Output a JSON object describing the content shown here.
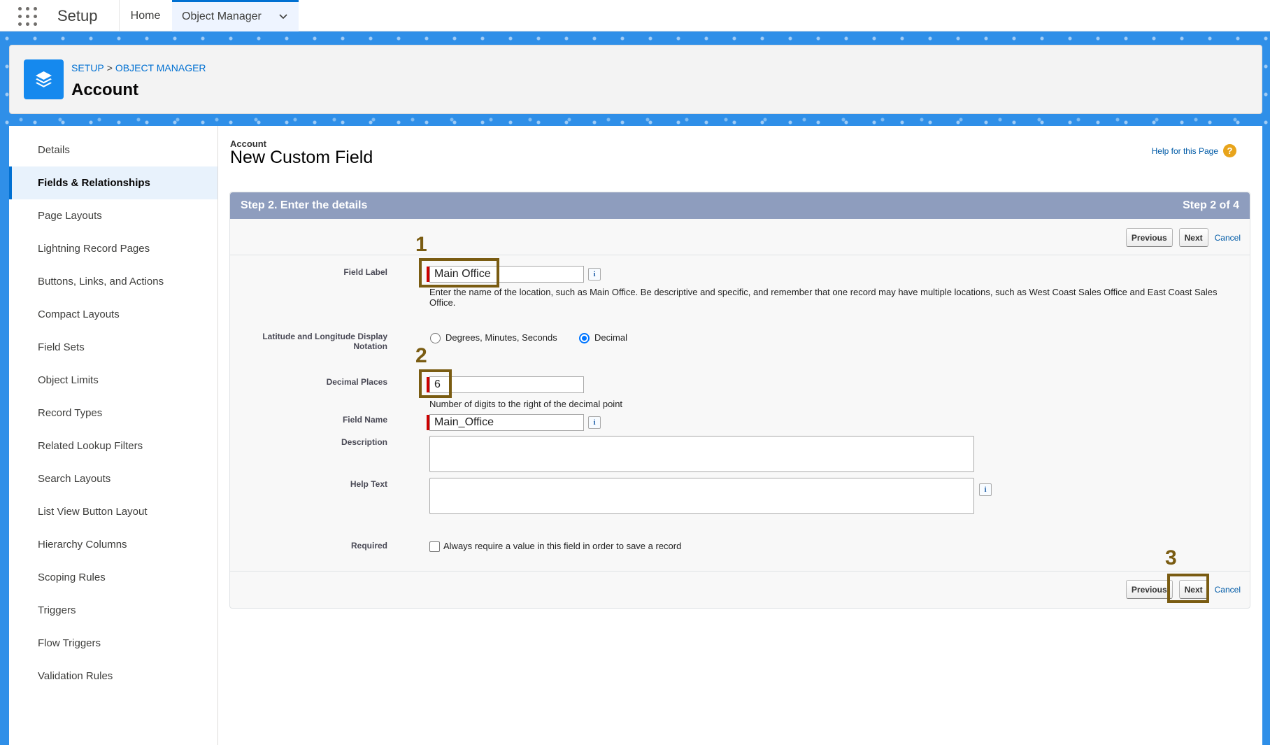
{
  "topnav": {
    "app_name": "Setup",
    "home": "Home",
    "object_manager": "Object Manager"
  },
  "header": {
    "breadcrumb_setup": "SETUP",
    "breadcrumb_sep": ">",
    "breadcrumb_om": "OBJECT MANAGER",
    "title": "Account"
  },
  "sidebar": {
    "items": [
      {
        "label": "Details"
      },
      {
        "label": "Fields & Relationships",
        "active": true
      },
      {
        "label": "Page Layouts"
      },
      {
        "label": "Lightning Record Pages"
      },
      {
        "label": "Buttons, Links, and Actions"
      },
      {
        "label": "Compact Layouts"
      },
      {
        "label": "Field Sets"
      },
      {
        "label": "Object Limits"
      },
      {
        "label": "Record Types"
      },
      {
        "label": "Related Lookup Filters"
      },
      {
        "label": "Search Layouts"
      },
      {
        "label": "List View Button Layout"
      },
      {
        "label": "Hierarchy Columns"
      },
      {
        "label": "Scoping Rules"
      },
      {
        "label": "Triggers"
      },
      {
        "label": "Flow Triggers"
      },
      {
        "label": "Validation Rules"
      }
    ]
  },
  "content": {
    "object": "Account",
    "title": "New Custom Field",
    "help_link": "Help for this Page",
    "help_icon": "?",
    "step_title": "Step 2. Enter the details",
    "step_count": "Step 2 of 4",
    "previous": "Previous",
    "next": "Next",
    "cancel": "Cancel",
    "info_glyph": "i"
  },
  "form": {
    "field_label": {
      "label": "Field Label",
      "value": "Main Office",
      "hint": "Enter the name of the location, such as Main Office. Be descriptive and specific, and remember that one record may have multiple locations, such as West Coast Sales Office and East Coast Sales Office."
    },
    "notation": {
      "label": "Latitude and Longitude Display Notation",
      "option_dms": "Degrees, Minutes, Seconds",
      "option_decimal": "Decimal",
      "selected": "Decimal"
    },
    "decimal_places": {
      "label": "Decimal Places",
      "value": "6",
      "hint": "Number of digits to the right of the decimal point"
    },
    "field_name": {
      "label": "Field Name",
      "value": "Main_Office"
    },
    "description": {
      "label": "Description",
      "value": ""
    },
    "help_text": {
      "label": "Help Text",
      "value": ""
    },
    "required": {
      "label": "Required",
      "checkbox_label": "Always require a value in this field in order to save a record",
      "checked": false
    }
  },
  "annotations": [
    "1",
    "2",
    "3"
  ],
  "colors": {
    "brand_blue": "#2f8fe8",
    "step_header": "#8e9dbe",
    "annotation": "#7a5c12",
    "required_bar": "#cc0000"
  }
}
